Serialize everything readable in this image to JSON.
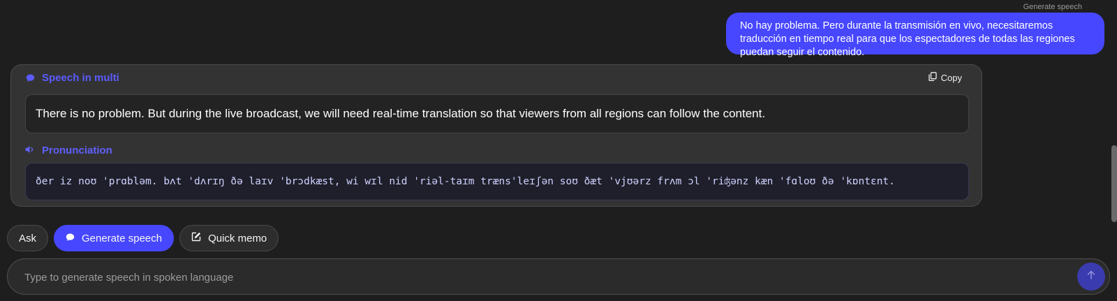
{
  "top_label": "Generate speech",
  "user_message": "No hay problema. Pero durante la transmisión en vivo, necesitaremos traducción en tiempo real para que los espectadores de todas las regiones puedan seguir el contenido.",
  "speech_card": {
    "title": "Speech in multi",
    "title_icon": "chat-bubble-icon",
    "copy_label": "Copy",
    "copy_icon": "copy-icon",
    "translation": "There is no problem. But during the live broadcast, we will need real-time translation so that viewers from all regions can follow the content.",
    "pronunciation_title": "Pronunciation",
    "pronunciation_icon": "speaker-icon",
    "pronunciation": "ðer iz noʊ 'prɑbləm. bʌt 'dʌrɪŋ ðə laɪv 'brɔdkæst, wi wɪl nid 'riəl-taɪm træns'leɪʃən soʊ ðæt 'vjʊərz frʌm ɔl 'riʤənz kæn 'fɑloʊ ðə 'kɒntɛnt."
  },
  "actions": {
    "ask_label": "Ask",
    "generate_label": "Generate speech",
    "generate_icon": "chat-bubble-icon",
    "memo_label": "Quick memo",
    "memo_icon": "edit-icon"
  },
  "input": {
    "placeholder": "Type to generate speech in spoken language",
    "value": "",
    "send_icon": "arrow-up-icon"
  },
  "colors": {
    "accent": "#4747ff",
    "background": "#1e1e1e",
    "card": "#333333"
  }
}
